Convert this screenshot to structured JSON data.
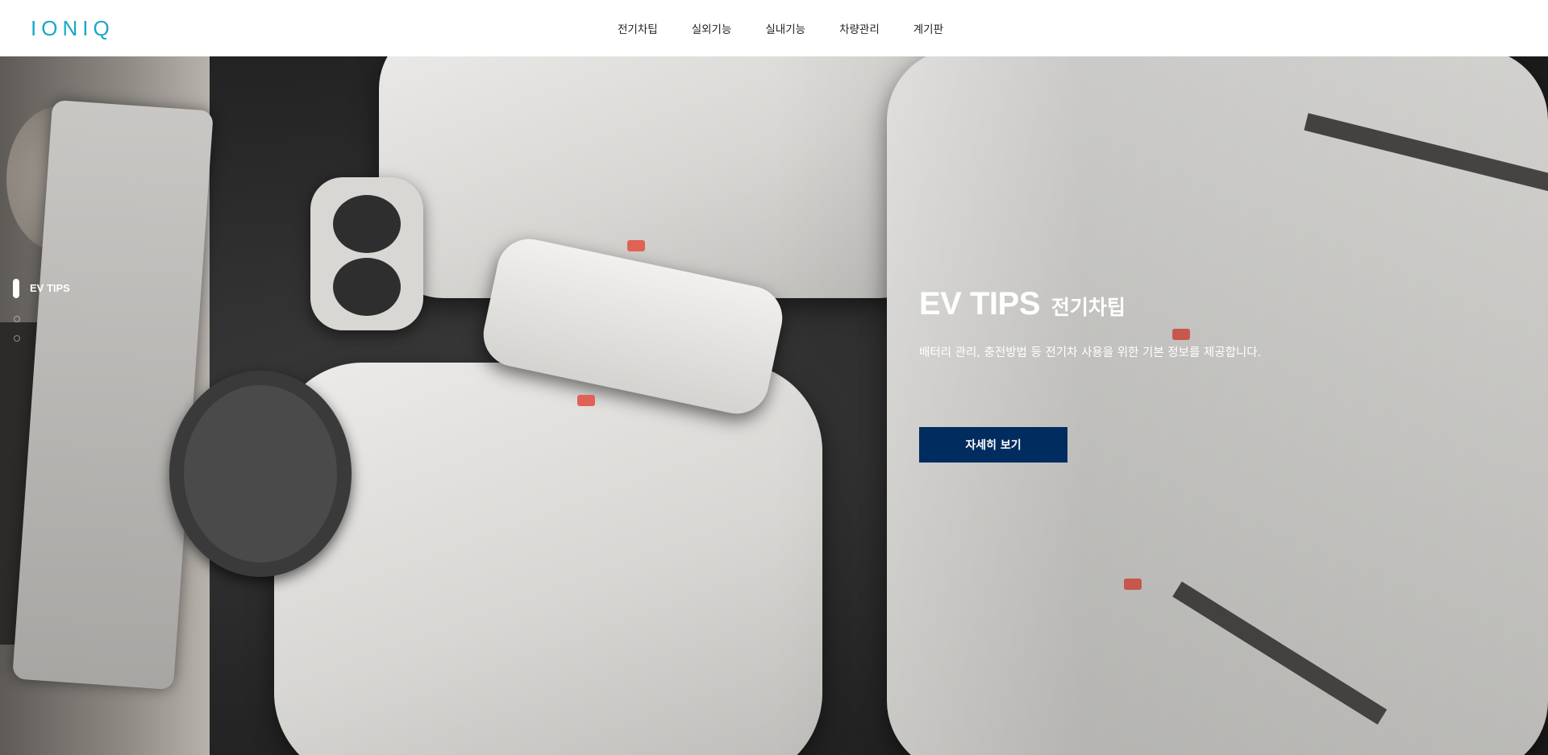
{
  "header": {
    "logo_text": "IONIQ",
    "nav": [
      {
        "label": "전기차팁"
      },
      {
        "label": "실외기능"
      },
      {
        "label": "실내기능"
      },
      {
        "label": "차량관리"
      },
      {
        "label": "계기판"
      }
    ]
  },
  "side_nav": {
    "active_label": "EV TIPS"
  },
  "hero": {
    "title_en": "EV TIPS",
    "title_ko": "전기차팁",
    "description": "배터리 관리, 충전방법 등 전기차 사용을 위한 기본 정보를 제공합니다.",
    "cta_label": "자세히 보기"
  },
  "colors": {
    "brand": "#1aa7c8",
    "cta_bg": "#002c5f",
    "seat_buckle": "#e06257"
  }
}
